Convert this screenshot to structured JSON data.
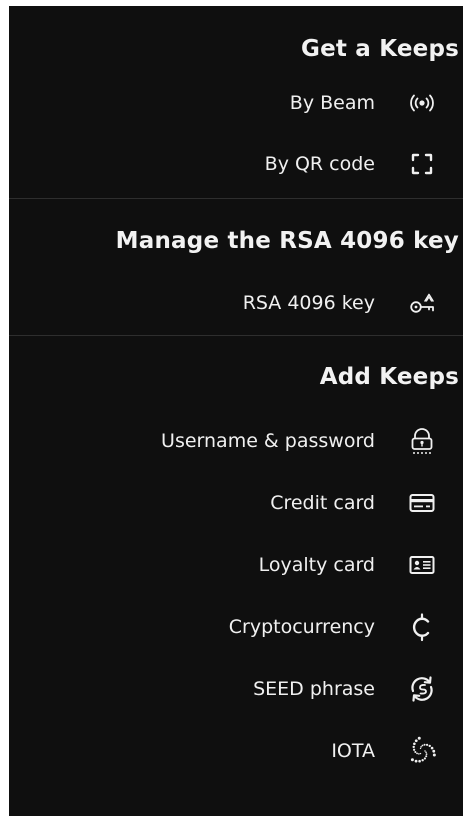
{
  "sections": [
    {
      "title": "Get a Keeps",
      "items": [
        {
          "label": "By Beam",
          "icon": "nfc-beam-icon"
        },
        {
          "label": "By QR code",
          "icon": "qr-scan-icon"
        }
      ]
    },
    {
      "title": "Manage the RSA 4096 key",
      "items": [
        {
          "label": "RSA 4096 key",
          "icon": "key-icon"
        }
      ]
    },
    {
      "title": "Add Keeps",
      "items": [
        {
          "label": "Username & password",
          "icon": "password-lock-icon"
        },
        {
          "label": "Credit card",
          "icon": "credit-card-icon"
        },
        {
          "label": "Loyalty card",
          "icon": "loyalty-card-icon"
        },
        {
          "label": "Cryptocurrency",
          "icon": "cryptocurrency-icon"
        },
        {
          "label": "SEED phrase",
          "icon": "seed-phrase-icon"
        },
        {
          "label": "IOTA",
          "icon": "iota-icon"
        }
      ]
    }
  ],
  "colors": {
    "background": "#0f0f0f",
    "text": "#f0f0f0",
    "divider": "#2e2e2e"
  }
}
